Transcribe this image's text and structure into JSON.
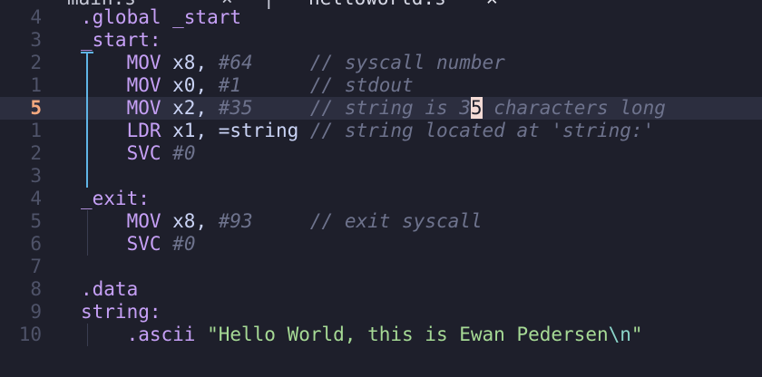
{
  "tabs": {
    "left_label": "main.s",
    "left_close": "×",
    "separator": "|",
    "right_label": "helloworld.s",
    "right_close": "✕"
  },
  "lines": [
    {
      "num": "4",
      "indent": "",
      "parts": [
        {
          "t": ".global _start",
          "c": "dir"
        }
      ]
    },
    {
      "num": "3",
      "indent": "",
      "parts": [
        {
          "t": "_start:",
          "c": "lbl"
        }
      ]
    },
    {
      "num": "2",
      "indent": "    ",
      "parts": [
        {
          "t": "MOV",
          "c": "op"
        },
        {
          "t": " x8, ",
          "c": "plain"
        },
        {
          "t": "#64",
          "c": "imm"
        },
        {
          "t": "     ",
          "c": "plain"
        },
        {
          "t": "// syscall number",
          "c": "cmt"
        }
      ]
    },
    {
      "num": "1",
      "indent": "    ",
      "parts": [
        {
          "t": "MOV",
          "c": "op"
        },
        {
          "t": " x0, ",
          "c": "plain"
        },
        {
          "t": "#1",
          "c": "imm"
        },
        {
          "t": "      ",
          "c": "plain"
        },
        {
          "t": "// stdout",
          "c": "cmt"
        }
      ]
    },
    {
      "num": "5",
      "indent": "    ",
      "current": true,
      "parts": [
        {
          "t": "MOV",
          "c": "op"
        },
        {
          "t": " x2, ",
          "c": "plain"
        },
        {
          "t": "#35",
          "c": "imm"
        },
        {
          "t": "     ",
          "c": "plain"
        },
        {
          "t": "// string is 3",
          "c": "cmt"
        },
        {
          "t": "5",
          "c": "cursor"
        },
        {
          "t": " characters long",
          "c": "cmt"
        }
      ]
    },
    {
      "num": "1",
      "indent": "    ",
      "parts": [
        {
          "t": "LDR",
          "c": "op"
        },
        {
          "t": " x1, =string ",
          "c": "plain"
        },
        {
          "t": "// string located at 'string:'",
          "c": "cmt"
        }
      ]
    },
    {
      "num": "2",
      "indent": "    ",
      "parts": [
        {
          "t": "SVC",
          "c": "op"
        },
        {
          "t": " ",
          "c": "plain"
        },
        {
          "t": "#0",
          "c": "imm"
        }
      ]
    },
    {
      "num": "3",
      "indent": "",
      "parts": []
    },
    {
      "num": "4",
      "indent": "",
      "parts": [
        {
          "t": "_exit:",
          "c": "lbl"
        }
      ]
    },
    {
      "num": "5",
      "indent": "    ",
      "parts": [
        {
          "t": "MOV",
          "c": "op"
        },
        {
          "t": " x8, ",
          "c": "plain"
        },
        {
          "t": "#93",
          "c": "imm"
        },
        {
          "t": "     ",
          "c": "plain"
        },
        {
          "t": "// exit syscall",
          "c": "cmt"
        }
      ]
    },
    {
      "num": "6",
      "indent": "    ",
      "parts": [
        {
          "t": "SVC",
          "c": "op"
        },
        {
          "t": " ",
          "c": "plain"
        },
        {
          "t": "#0",
          "c": "imm"
        }
      ]
    },
    {
      "num": "7",
      "indent": "",
      "parts": []
    },
    {
      "num": "8",
      "indent": "",
      "parts": [
        {
          "t": ".data",
          "c": "dir"
        }
      ]
    },
    {
      "num": "9",
      "indent": "",
      "parts": [
        {
          "t": "string:",
          "c": "lbl"
        }
      ]
    },
    {
      "num": "10",
      "indent": "    ",
      "parts": [
        {
          "t": ".ascii",
          "c": "dir"
        },
        {
          "t": " ",
          "c": "plain"
        },
        {
          "t": "\"Hello World, this is Ewan Pedersen",
          "c": "str"
        },
        {
          "t": "\\n",
          "c": "esc"
        },
        {
          "t": "\"",
          "c": "str"
        }
      ]
    }
  ]
}
